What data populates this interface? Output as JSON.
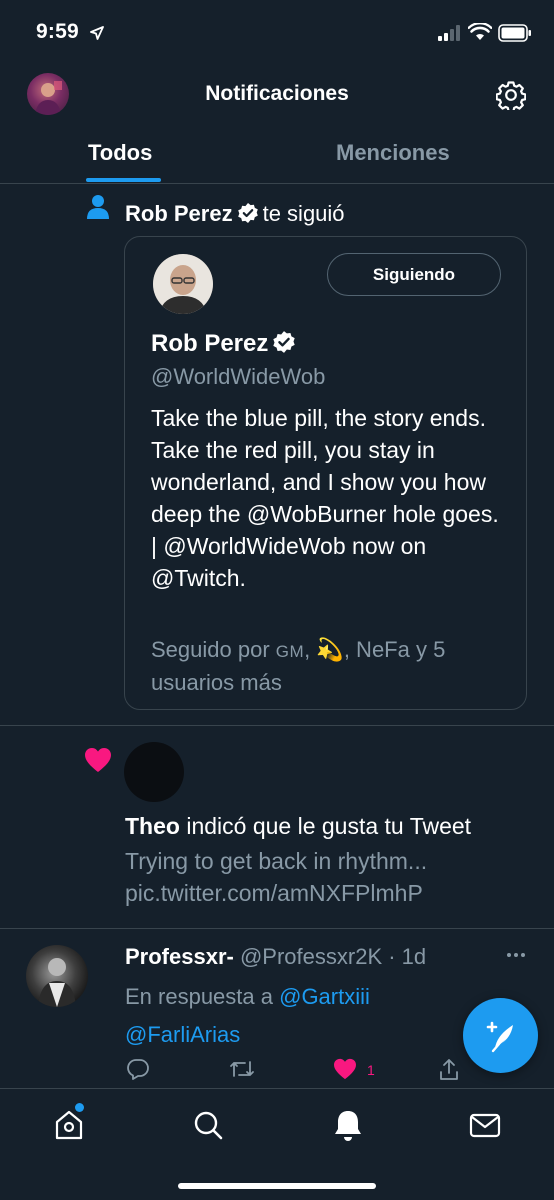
{
  "status_bar": {
    "time": "9:59"
  },
  "header": {
    "title": "Notificaciones"
  },
  "tabs": [
    {
      "label": "Todos",
      "active": true
    },
    {
      "label": "Menciones",
      "active": false
    }
  ],
  "follow_notification": {
    "user_name": "Rob Perez",
    "action_text": "te siguió",
    "card": {
      "button_label": "Siguiendo",
      "name": "Rob Perez",
      "handle": "@WorldWideWob",
      "bio": "Take the blue pill, the story ends. Take the red pill, you stay in wonderland, and I show you how deep the @WobBurner hole goes. | @WorldWideWob now on @Twitch.",
      "followed_by_prefix": "Seguido por",
      "followed_by_gm": "GM",
      "followed_by_emoji": "💫",
      "followed_by_suffix": ", NeFa y 5 usuarios más"
    }
  },
  "like_notification": {
    "user_name": "Theo",
    "action_text": "indicó que le gusta tu Tweet",
    "tweet_text_line1": "Trying to get back in rhythm...",
    "tweet_text_line2": "pic.twitter.com/amNXFPlmhP"
  },
  "reply_tweet": {
    "name": "Professxr-",
    "handle_time": "@Professxr2K · 1d",
    "reply_prefix": "En respuesta a",
    "mention_1": "@Gartxiii",
    "mention_2": "@FarliArias",
    "like_count": "1"
  },
  "colors": {
    "background": "#15202b",
    "accent": "#1d9bf0",
    "like": "#f91880",
    "secondary_text": "#8899a6",
    "divider": "#38444d"
  },
  "icons": {
    "status": [
      "location-arrow-icon",
      "signal-icon",
      "wifi-icon",
      "battery-icon"
    ],
    "nav": [
      "home-icon",
      "search-icon",
      "bell-icon",
      "mail-icon"
    ],
    "actions": [
      "reply-icon",
      "retweet-icon",
      "heart-icon",
      "share-icon"
    ]
  }
}
